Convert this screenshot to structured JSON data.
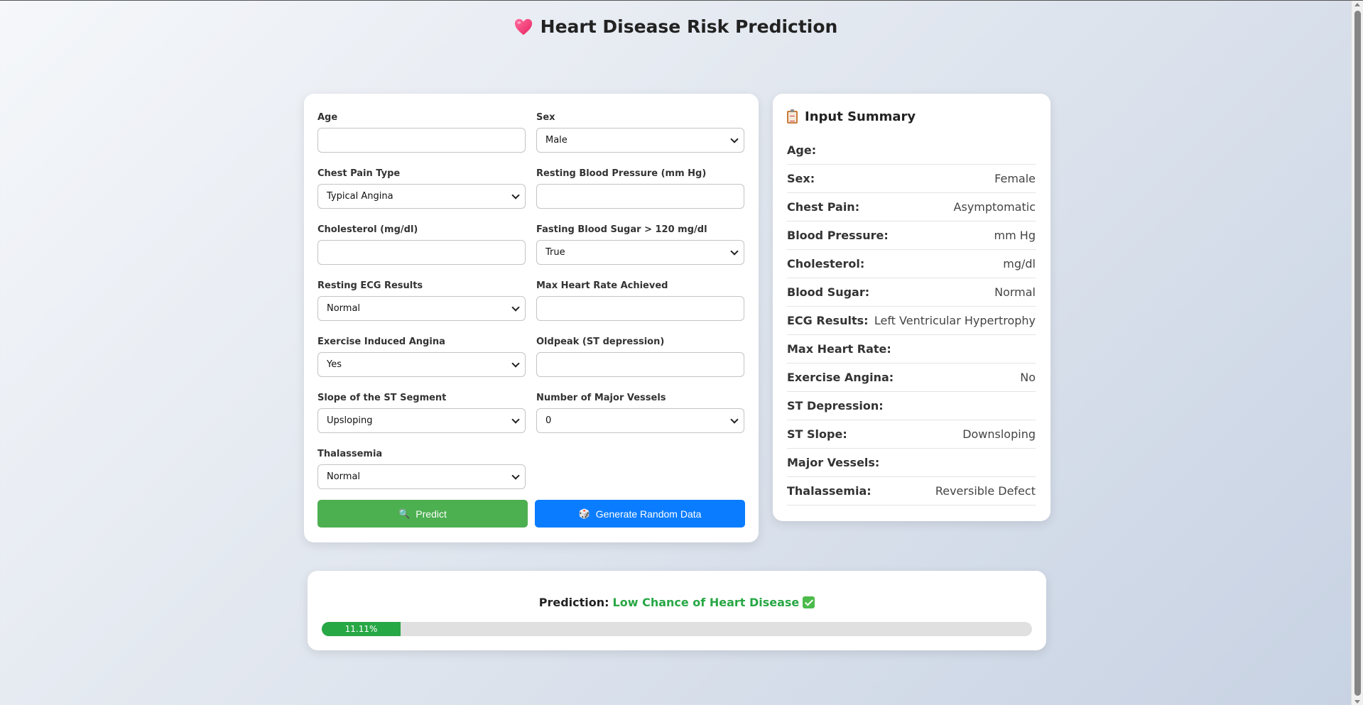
{
  "header": {
    "title": "Heart Disease Risk Prediction"
  },
  "form": {
    "age": {
      "label": "Age",
      "value": ""
    },
    "sex": {
      "label": "Sex",
      "value": "Male"
    },
    "chest_pain": {
      "label": "Chest Pain Type",
      "value": "Typical Angina"
    },
    "resting_bp": {
      "label": "Resting Blood Pressure (mm Hg)",
      "value": ""
    },
    "cholesterol": {
      "label": "Cholesterol (mg/dl)",
      "value": ""
    },
    "fasting_bs": {
      "label": "Fasting Blood Sugar > 120 mg/dl",
      "value": "True"
    },
    "resting_ecg": {
      "label": "Resting ECG Results",
      "value": "Normal"
    },
    "max_hr": {
      "label": "Max Heart Rate Achieved",
      "value": ""
    },
    "exercise_angina": {
      "label": "Exercise Induced Angina",
      "value": "Yes"
    },
    "oldpeak": {
      "label": "Oldpeak (ST depression)",
      "value": ""
    },
    "st_slope": {
      "label": "Slope of the ST Segment",
      "value": "Upsloping"
    },
    "major_vessels": {
      "label": "Number of Major Vessels",
      "value": "0"
    },
    "thalassemia": {
      "label": "Thalassemia",
      "value": "Normal"
    },
    "predict_label": "Predict",
    "random_label": "Generate Random Data"
  },
  "summary": {
    "title": "Input Summary",
    "rows": [
      {
        "key": "Age:",
        "value": ""
      },
      {
        "key": "Sex:",
        "value": "Female"
      },
      {
        "key": "Chest Pain:",
        "value": "Asymptomatic"
      },
      {
        "key": "Blood Pressure:",
        "value": "mm Hg"
      },
      {
        "key": "Cholesterol:",
        "value": "mg/dl"
      },
      {
        "key": "Blood Sugar:",
        "value": "Normal"
      },
      {
        "key": "ECG Results:",
        "value": "Left Ventricular Hypertrophy"
      },
      {
        "key": "Max Heart Rate:",
        "value": ""
      },
      {
        "key": "Exercise Angina:",
        "value": "No"
      },
      {
        "key": "ST Depression:",
        "value": ""
      },
      {
        "key": "ST Slope:",
        "value": "Downsloping"
      },
      {
        "key": "Major Vessels:",
        "value": ""
      },
      {
        "key": "Thalassemia:",
        "value": "Reversible Defect"
      }
    ]
  },
  "result": {
    "prefix": "Prediction:",
    "value": "Low Chance of Heart Disease",
    "probability_label": "11.11%",
    "probability": 0.1111
  },
  "colors": {
    "predict_button": "#4caf50",
    "random_button": "#0a7cff",
    "result_green": "#28a745"
  }
}
